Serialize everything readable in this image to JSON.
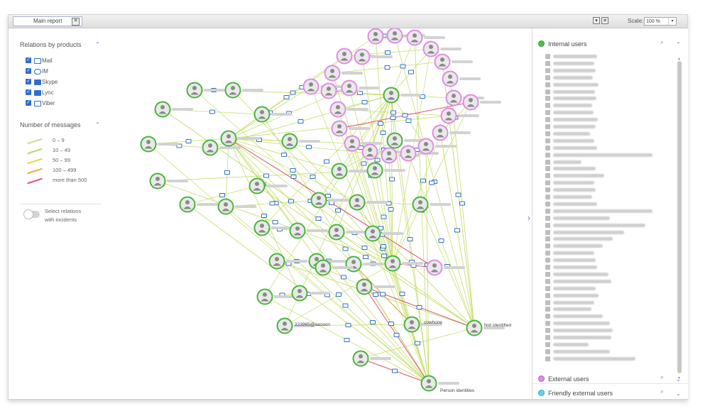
{
  "toolbar": {
    "tab_label": "Main report",
    "close_symbol": "✕",
    "minimize_symbol": "▾",
    "max_symbol": "✕",
    "scale_label": "Scale:",
    "scale_value": "100 %",
    "scale_dropdown": "▾"
  },
  "left_panel": {
    "products_title": "Relations by products",
    "collapse_caret": "⌃",
    "products": [
      {
        "label": "Mail",
        "icon": "mail-icon",
        "checked": true
      },
      {
        "label": "IM",
        "icon": "im-icon",
        "checked": true
      },
      {
        "label": "Skype",
        "icon": "skype-icon",
        "checked": true
      },
      {
        "label": "Lync",
        "icon": "lync-icon",
        "checked": true
      },
      {
        "label": "Viber",
        "icon": "viber-icon",
        "checked": true
      }
    ],
    "messages_title": "Number of messages",
    "legend": [
      {
        "label": "0 – 9",
        "color": "#c8e08a"
      },
      {
        "label": "10 – 49",
        "color": "#b6dc66"
      },
      {
        "label": "50 – 99",
        "color": "#d9dc44"
      },
      {
        "label": "100 – 499",
        "color": "#e6b04a"
      },
      {
        "label": "more than 500",
        "color": "#e0507a"
      }
    ],
    "toggle_label_1": "Select relations",
    "toggle_label_2": "with incidents",
    "toggle_on": false
  },
  "graph": {
    "colors": {
      "internal": "#4caf3e",
      "external": "#d98be0",
      "edge": "#c4dd6a",
      "edge_red": "#e0507a",
      "edge_orange": "#d7a24a",
      "envelope": "#2f6fc7"
    },
    "visible_labels": [
      "223965@aaoaon",
      "cowhone",
      "Not identified",
      "Person identities"
    ]
  },
  "right_panel": {
    "internal_title": "Internal users",
    "internal_color": "#4cc24a",
    "external_title": "External users",
    "external_color": "#e28ae6",
    "friendly_title": "Friendly external users",
    "friendly_color": "#58d8e8",
    "search_symbol": "⌕",
    "caret_up": "⌃",
    "caret_down": "⌄",
    "collapse_arrow": "›"
  }
}
